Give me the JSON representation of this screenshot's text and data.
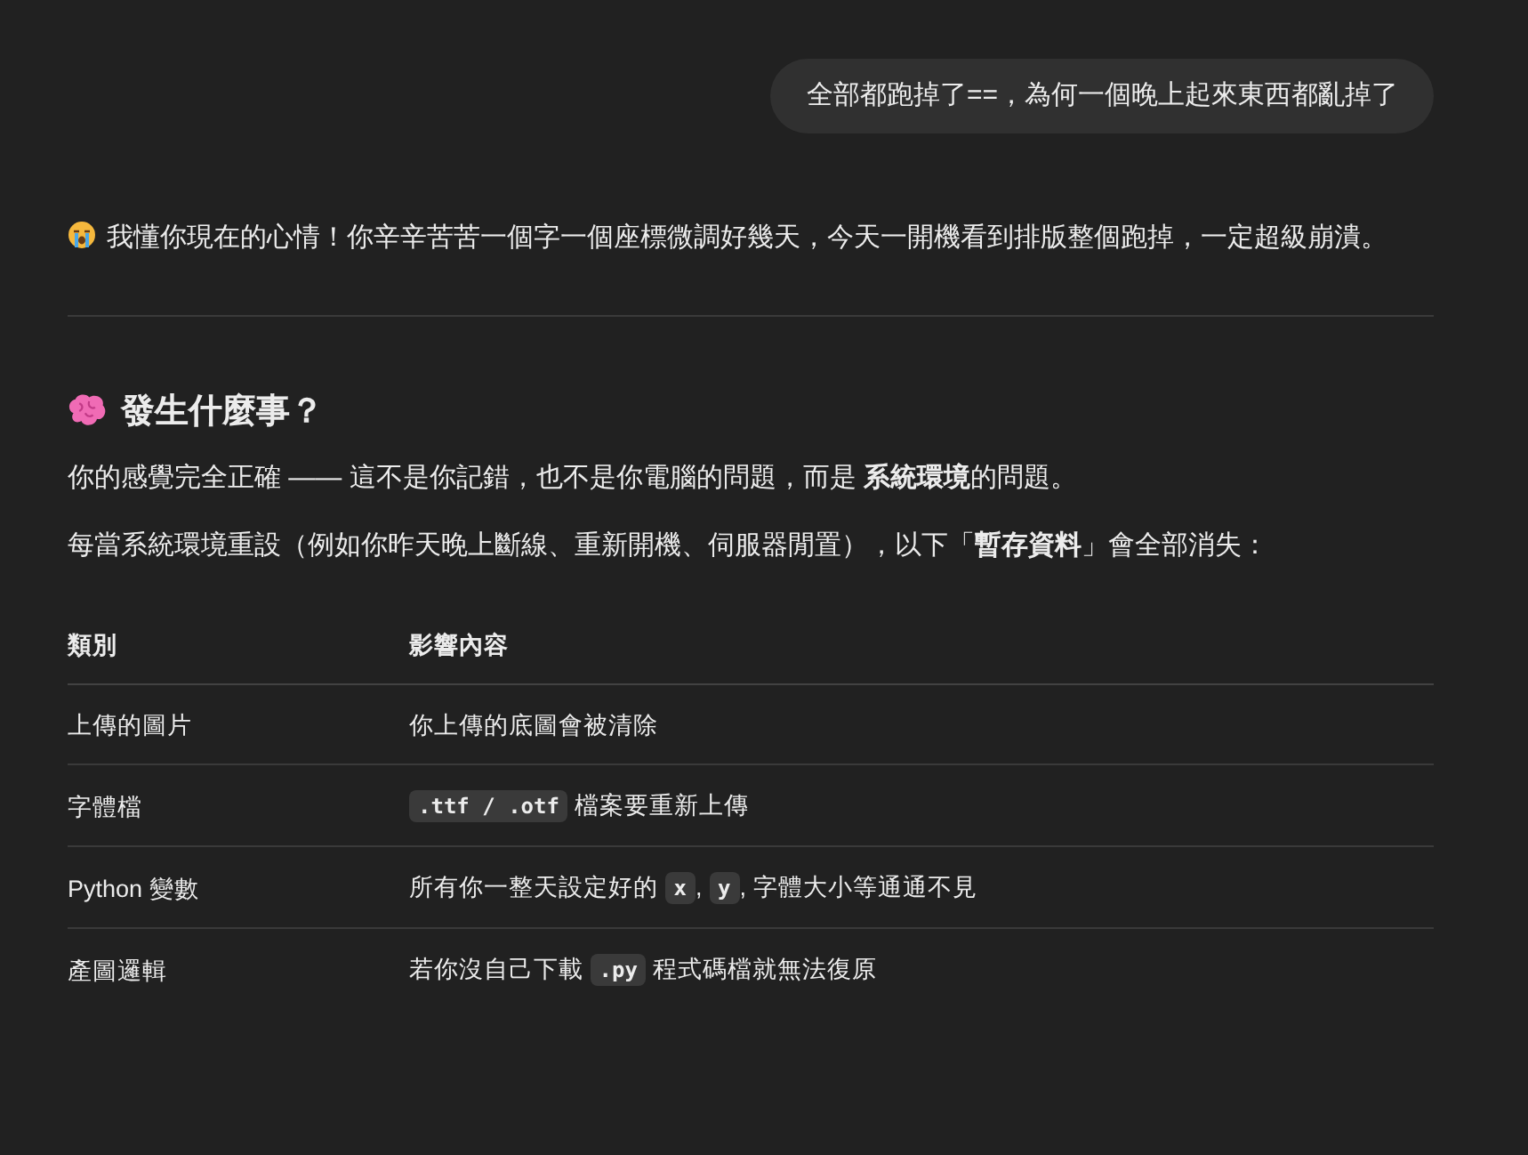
{
  "user_message": {
    "text": "全部都跑掉了==，為何一個晚上起來東西都亂掉了"
  },
  "reply": {
    "intro": "我懂你現在的心情！你辛辛苦苦一個字一個座標微調好幾天，今天一開機看到排版整個跑掉，一定超級崩潰。",
    "heading": "發生什麼事？",
    "paragraphs": [
      "你的感覺完全正確 —— 這不是你記錯，也不是你電腦的問題，而是 **系統環境**的問題。",
      "每當系統環境重設（例如你昨天晚上斷線、重新開機、伺服器閒置），以下「**暫存資料**」會全部消失："
    ],
    "table": {
      "columns": [
        "類別",
        "影響內容"
      ],
      "rows": [
        {
          "category": "上傳的圖片",
          "effect": [
            {
              "kind": "text",
              "text": "你上傳的底圖會被清除"
            }
          ]
        },
        {
          "category": "字體檔",
          "effect": [
            {
              "kind": "code",
              "text": ".ttf / .otf"
            },
            {
              "kind": "text",
              "text": " 檔案要重新上傳"
            }
          ]
        },
        {
          "category": "Python 變數",
          "effect": [
            {
              "kind": "text",
              "text": "所有你一整天設定好的 "
            },
            {
              "kind": "code",
              "text": "x"
            },
            {
              "kind": "text",
              "text": ", "
            },
            {
              "kind": "code",
              "text": "y"
            },
            {
              "kind": "text",
              "text": ", 字體大小等通通不見"
            }
          ]
        },
        {
          "category": "產圖邏輯",
          "effect": [
            {
              "kind": "text",
              "text": "若你沒自己下載 "
            },
            {
              "kind": "code",
              "text": ".py"
            },
            {
              "kind": "text",
              "text": " 程式碼檔就無法復原"
            }
          ]
        }
      ]
    }
  }
}
